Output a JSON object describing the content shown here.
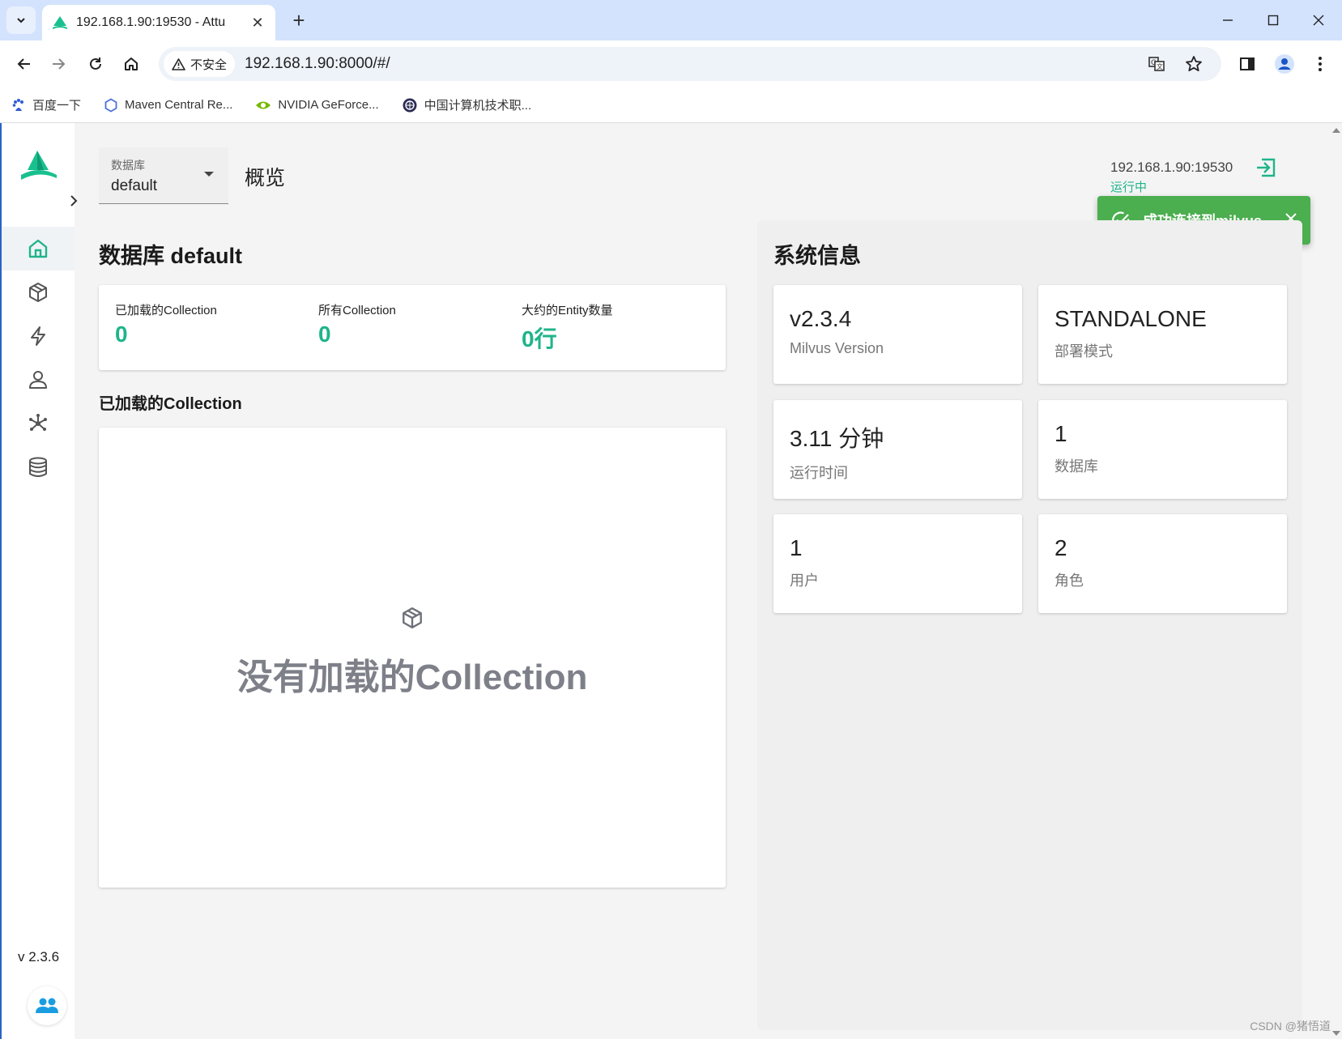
{
  "browser": {
    "tab_title": "192.168.1.90:19530 - Attu",
    "security_label": "不安全",
    "url": "192.168.1.90:8000/#/",
    "bookmarks": [
      {
        "label": "百度一下"
      },
      {
        "label": "Maven Central Re..."
      },
      {
        "label": "NVIDIA GeForce..."
      },
      {
        "label": "中国计算机技术职..."
      }
    ]
  },
  "sidebar": {
    "version": "v 2.3.6"
  },
  "header": {
    "db_label": "数据库",
    "db_value": "default",
    "page_title": "概览",
    "server_address": "192.168.1.90:19530",
    "server_status": "运行中"
  },
  "toast": {
    "message": "成功连接到milvus"
  },
  "database": {
    "title": "数据库 default",
    "stats": [
      {
        "label": "已加载的Collection",
        "value": "0"
      },
      {
        "label": "所有Collection",
        "value": "0"
      },
      {
        "label": "大约的Entity数量",
        "value": "0行"
      }
    ],
    "loaded_title": "已加载的Collection",
    "empty_text": "没有加载的Collection"
  },
  "system": {
    "title": "系统信息",
    "cards": [
      {
        "value": "v2.3.4",
        "label": "Milvus Version"
      },
      {
        "value": "STANDALONE",
        "label": "部署模式"
      },
      {
        "value": "3.11 分钟",
        "label": "运行时间"
      },
      {
        "value": "1",
        "label": "数据库"
      },
      {
        "value": "1",
        "label": "用户"
      },
      {
        "value": "2",
        "label": "角色"
      }
    ]
  },
  "watermark": "CSDN @猪悟道",
  "colors": {
    "accent": "#1fb48a",
    "toast": "#4bae4f",
    "tabstrip": "#d3e3fd"
  }
}
